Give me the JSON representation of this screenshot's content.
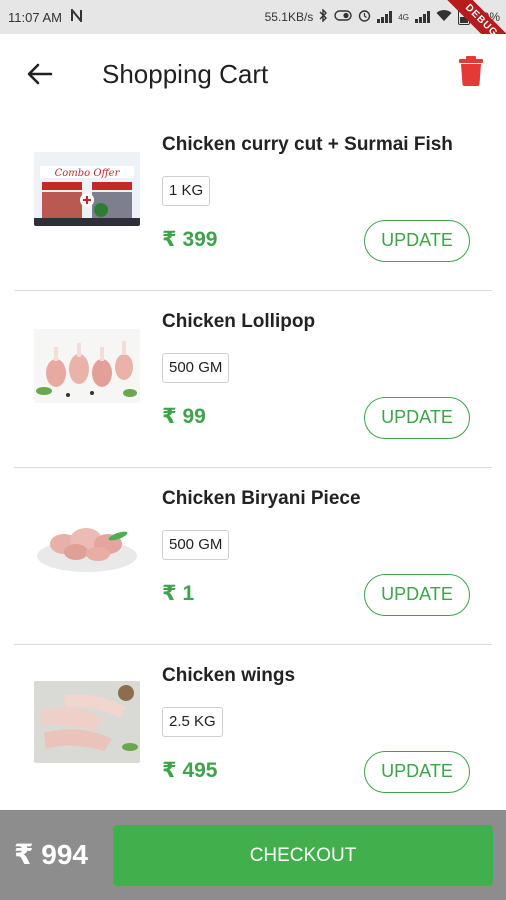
{
  "status_bar": {
    "time": "11:07 AM",
    "network_speed": "55.1KB/s",
    "network_type": "4G",
    "battery": "49%",
    "debug_label": "DEBUG"
  },
  "header": {
    "title": "Shopping Cart",
    "back_icon": "arrow-left-icon",
    "delete_icon": "trash-icon"
  },
  "cart": {
    "items": [
      {
        "name": "Chicken curry cut + Surmai Fish",
        "quantity": "1 KG",
        "price": "₹ 399",
        "update_label": "UPDATE",
        "image": "combo-offer-image"
      },
      {
        "name": "Chicken Lollipop",
        "quantity": "500 GM",
        "price": "₹ 99",
        "update_label": "UPDATE",
        "image": "lollipop-image"
      },
      {
        "name": "Chicken Biryani Piece",
        "quantity": "500 GM",
        "price": "₹ 1",
        "update_label": "UPDATE",
        "image": "biryani-piece-image"
      },
      {
        "name": "Chicken wings",
        "quantity": "2.5 KG",
        "price": "₹ 495",
        "update_label": "UPDATE",
        "image": "wings-image"
      }
    ]
  },
  "footer": {
    "total": "₹ 994",
    "checkout_label": "CHECKOUT"
  },
  "colors": {
    "accent": "#3ea34b",
    "checkout": "#41b04c",
    "delete": "#e53935",
    "bottom_bar": "#8d8d8d"
  }
}
